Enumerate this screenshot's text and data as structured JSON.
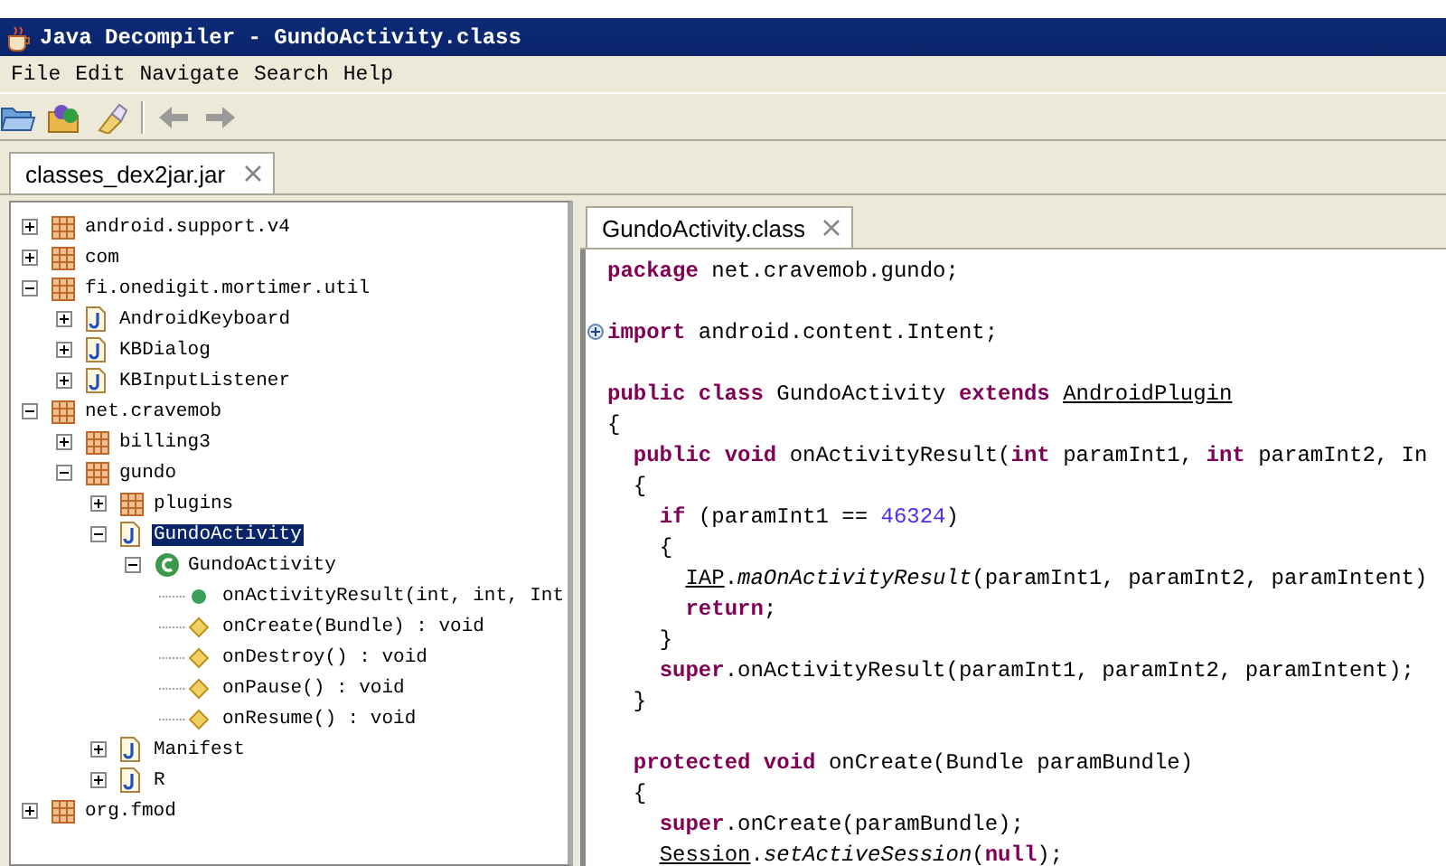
{
  "window": {
    "title": "Java Decompiler - GundoActivity.class"
  },
  "menu": [
    "File",
    "Edit",
    "Navigate",
    "Search",
    "Help"
  ],
  "toolbar": [
    {
      "kind": "open"
    },
    {
      "kind": "open-type"
    },
    {
      "kind": "search"
    },
    {
      "kind": "separator"
    },
    {
      "kind": "back",
      "disabled": true
    },
    {
      "kind": "forward",
      "disabled": true
    }
  ],
  "file_tabs": [
    {
      "label": "classes_dex2jar.jar",
      "selected": true
    }
  ],
  "tree": [
    {
      "label": "android.support.v4",
      "kind": "package",
      "expanded": false
    },
    {
      "label": "com",
      "kind": "package",
      "expanded": false
    },
    {
      "label": "fi.onedigit.mortimer.util",
      "kind": "package",
      "expanded": true,
      "children": [
        {
          "label": "AndroidKeyboard",
          "kind": "file",
          "expanded": false
        },
        {
          "label": "KBDialog",
          "kind": "file",
          "expanded": false
        },
        {
          "label": "KBInputListener",
          "kind": "file",
          "expanded": false
        }
      ]
    },
    {
      "label": "net.cravemob",
      "kind": "package",
      "expanded": true,
      "children": [
        {
          "label": "billing3",
          "kind": "package",
          "expanded": false
        },
        {
          "label": "gundo",
          "kind": "package",
          "expanded": true,
          "children": [
            {
              "label": "plugins",
              "kind": "package",
              "expanded": false
            },
            {
              "label": "GundoActivity",
              "kind": "file",
              "expanded": true,
              "selected": true,
              "children": [
                {
                  "label": "GundoActivity",
                  "kind": "class",
                  "expanded": true,
                  "children": [
                    {
                      "label": "onActivityResult(int, int, Int",
                      "kind": "public-method"
                    },
                    {
                      "label": "onCreate(Bundle) : void",
                      "kind": "protected-method"
                    },
                    {
                      "label": "onDestroy() : void",
                      "kind": "protected-method"
                    },
                    {
                      "label": "onPause() : void",
                      "kind": "protected-method"
                    },
                    {
                      "label": "onResume() : void",
                      "kind": "protected-method"
                    }
                  ]
                }
              ]
            },
            {
              "label": "Manifest",
              "kind": "file",
              "expanded": false
            },
            {
              "label": "R",
              "kind": "file",
              "expanded": false
            }
          ]
        }
      ]
    },
    {
      "label": "org.fmod",
      "kind": "package",
      "expanded": false
    }
  ],
  "editor_tabs": [
    {
      "label": "GundoActivity.class",
      "selected": true
    }
  ],
  "code": [
    {
      "kind": "code",
      "tokens": [
        {
          "kind": "keyword",
          "text": "package"
        },
        {
          "kind": "plain",
          "text": " net.cravemob.gundo;"
        }
      ]
    },
    {
      "kind": "blank"
    },
    {
      "kind": "code",
      "folded": true,
      "tokens": [
        {
          "kind": "keyword",
          "text": "import"
        },
        {
          "kind": "plain",
          "text": " android.content.Intent;"
        }
      ]
    },
    {
      "kind": "blank"
    },
    {
      "kind": "code",
      "tokens": [
        {
          "kind": "keyword",
          "text": "public class"
        },
        {
          "kind": "plain",
          "text": " GundoActivity "
        },
        {
          "kind": "keyword",
          "text": "extends "
        },
        {
          "kind": "type-ref",
          "text": "AndroidPlugin"
        }
      ]
    },
    {
      "kind": "code",
      "tokens": [
        {
          "kind": "plain",
          "text": "{"
        }
      ]
    },
    {
      "kind": "code",
      "tokens": [
        {
          "kind": "keyword",
          "text": "  public void"
        },
        {
          "kind": "plain",
          "text": " onActivityResult("
        },
        {
          "kind": "keyword",
          "text": "int"
        },
        {
          "kind": "plain",
          "text": " paramInt1, "
        },
        {
          "kind": "keyword",
          "text": "int"
        },
        {
          "kind": "plain",
          "text": " paramInt2, In"
        }
      ]
    },
    {
      "kind": "code",
      "tokens": [
        {
          "kind": "plain",
          "text": "  {"
        }
      ]
    },
    {
      "kind": "code",
      "tokens": [
        {
          "kind": "keyword",
          "text": "    if"
        },
        {
          "kind": "plain",
          "text": " (paramInt1 == "
        },
        {
          "kind": "number",
          "text": "46324"
        },
        {
          "kind": "plain",
          "text": ")"
        }
      ]
    },
    {
      "kind": "code",
      "tokens": [
        {
          "kind": "plain",
          "text": "    {"
        }
      ]
    },
    {
      "kind": "code",
      "tokens": [
        {
          "kind": "type-ref",
          "text": "      IAP"
        },
        {
          "kind": "plain",
          "text": "."
        },
        {
          "kind": "static-call",
          "text": "maOnActivityResult"
        },
        {
          "kind": "plain",
          "text": "(paramInt1, paramInt2, paramIntent)"
        }
      ]
    },
    {
      "kind": "code",
      "tokens": [
        {
          "kind": "keyword",
          "text": "      return"
        },
        {
          "kind": "plain",
          "text": ";"
        }
      ]
    },
    {
      "kind": "code",
      "tokens": [
        {
          "kind": "plain",
          "text": "    }"
        }
      ]
    },
    {
      "kind": "code",
      "tokens": [
        {
          "kind": "keyword",
          "text": "    super"
        },
        {
          "kind": "plain",
          "text": ".onActivityResult(paramInt1, paramInt2, paramIntent);"
        }
      ]
    },
    {
      "kind": "code",
      "tokens": [
        {
          "kind": "plain",
          "text": "  }"
        }
      ]
    },
    {
      "kind": "blank"
    },
    {
      "kind": "code",
      "tokens": [
        {
          "kind": "keyword",
          "text": "  protected void"
        },
        {
          "kind": "plain",
          "text": " onCreate(Bundle paramBundle)"
        }
      ]
    },
    {
      "kind": "code",
      "tokens": [
        {
          "kind": "plain",
          "text": "  {"
        }
      ]
    },
    {
      "kind": "code",
      "tokens": [
        {
          "kind": "keyword",
          "text": "    super"
        },
        {
          "kind": "plain",
          "text": ".onCreate(paramBundle);"
        }
      ]
    },
    {
      "kind": "code",
      "tokens": [
        {
          "kind": "type-ref",
          "text": "    Session"
        },
        {
          "kind": "plain",
          "text": "."
        },
        {
          "kind": "static-call",
          "text": "setActiveSession"
        },
        {
          "kind": "plain",
          "text": "("
        },
        {
          "kind": "keyword",
          "text": "null"
        },
        {
          "kind": "plain",
          "text": ");"
        }
      ]
    }
  ]
}
